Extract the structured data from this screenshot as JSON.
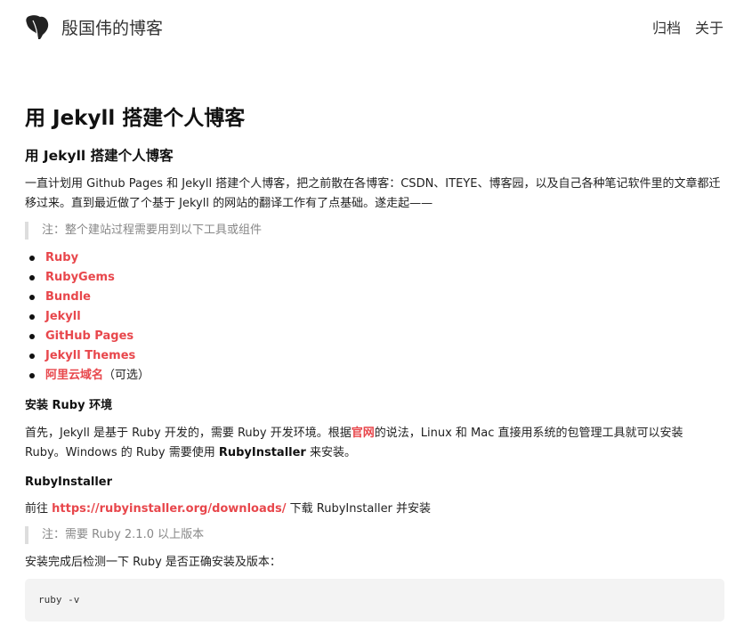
{
  "header": {
    "site_title": "殷国伟的博客",
    "nav": [
      "归档",
      "关于"
    ]
  },
  "post": {
    "title": "用 Jekyll 搭建个人博客",
    "h2": "用 Jekyll 搭建个人博客",
    "intro": "一直计划用 Github Pages 和 Jekyll 搭建个人博客，把之前散在各博客：CSDN、ITEYE、博客园，以及自己各种笔记软件里的文章都迁移过来。直到最近做了个基于 Jekyll 的网站的翻译工作有了点基础。遂走起——",
    "quote1": "注：整个建站过程需要用到以下工具或组件",
    "tools": [
      "Ruby",
      "RubyGems",
      "Bundle",
      "Jekyll",
      "GitHub Pages",
      "Jekyll Themes",
      "阿里云域名"
    ],
    "optional_suffix": "（可选）",
    "h3_install": "安装 Ruby 环境",
    "install_p_part1": "首先，Jekyll 是基于 Ruby 开发的，需要 Ruby 开发环境。根据",
    "install_p_link": "官网",
    "install_p_part2": "的说法，Linux 和 Mac 直接用系统的包管理工具就可以安装 Ruby。Windows 的 Ruby 需要使用 ",
    "install_p_strong": "RubyInstaller",
    "install_p_part3": " 来安装。",
    "h3_rubyinstaller": "RubyInstaller",
    "goto_prefix": "前往 ",
    "goto_link": "https://rubyinstaller.org/downloads/",
    "goto_suffix": " 下载 RubyInstaller 并安装",
    "quote2": "注：需要 Ruby 2.1.0 以上版本",
    "check_text": "安装完成后检测一下 Ruby 是否正确安装及版本：",
    "code": "ruby -v"
  },
  "colors": {
    "link_red": "#e8474c",
    "quote_border": "#dddddd",
    "code_bg": "#f3f3f3"
  },
  "icons": {
    "logo": "ginkgo-leaf-icon"
  }
}
